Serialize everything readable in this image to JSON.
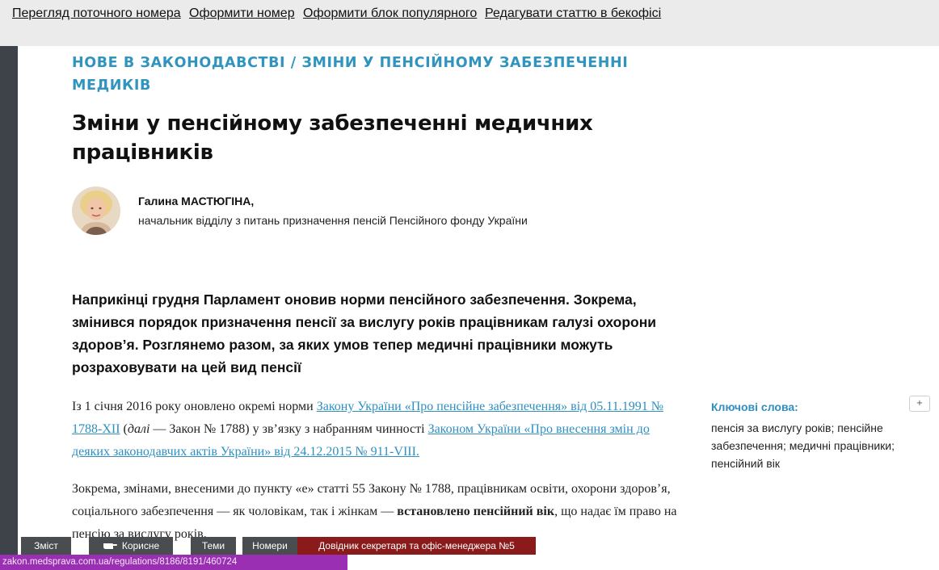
{
  "topbar": {
    "links": [
      "Перегляд поточного номера",
      "Оформити номер",
      "Оформити блок популярного",
      "Редагувати статтю в бекофісі"
    ]
  },
  "article": {
    "rubric": "НОВЕ В ЗАКОНОДАВСТВІ / ЗМІНИ У ПЕНСІЙНОМУ ЗАБЕЗПЕЧЕННІ МЕДИКІВ",
    "title": "Зміни у пенсійному забезпеченні медичних працівників",
    "author_name": "Галина МАСТЮГІНА,",
    "author_position": "начальник відділу з питань призначення пенсій Пенсійного фонду України",
    "lead": "Наприкінці грудня Парламент оновив норми пенсійного забезпечення. Зокрема, змінився порядок призначення пенсії за вислугу років працівникам галузі охорони здоров’я. Розглянемо разом, за яких умов тепер медичні працівники можуть розраховувати на цей вид пенсії",
    "p1_text1": "Із 1 січня 2016 року оновлено окремі норми ",
    "p1_link1": "Закону України «Про пенсійне забезпечення» від 05.11.1991 № 1788-XII",
    "p1_text2": " (",
    "p1_italic": "далі",
    "p1_text3": " — Закон № 1788) у зв’язку з набранням чинності ",
    "p1_link2": "Законом України «Про внесення змін до деяких законодавчих актів України» від 24.12.2015 № 911-VIII.",
    "p2_text1": "Зокрема, змінами, внесеними до пункту «е» статті 55 Закону № 1788, працівникам освіти, охорони здоров’я, соціального забезпечення — як чоловікам, так і жінкам — ",
    "p2_bold": "встановлено пенсійний вік",
    "p2_text2": ", що надає їм право на пенсію за вислугу років."
  },
  "keywords": {
    "title": "Ключові слова:",
    "list": "пенсія за вислугу років; пенсійне забезпечення; медичні працівники; пенсійний вік"
  },
  "comment_button": "+",
  "bottom_tabs": {
    "zmist": "Зміст",
    "korysne": "Корисне",
    "temy": "Теми",
    "nomery": "Номери",
    "dovidnyk": "Довідник секретаря та офіс-менеджера №5"
  },
  "status_url": "zakon.medsprava.com.ua/regulations/8186/8191/460724",
  "colors": {
    "accent": "#2f95bf",
    "topbar_bg": "#ebebeb",
    "left_strip": "#3d4348",
    "tab_dark": "#4a4d50",
    "tab_red": "#8b1a1a",
    "status_bg": "#9b2fb3"
  },
  "icons": {
    "avatar": "author-photo",
    "hand": "pointing-hand-icon"
  }
}
